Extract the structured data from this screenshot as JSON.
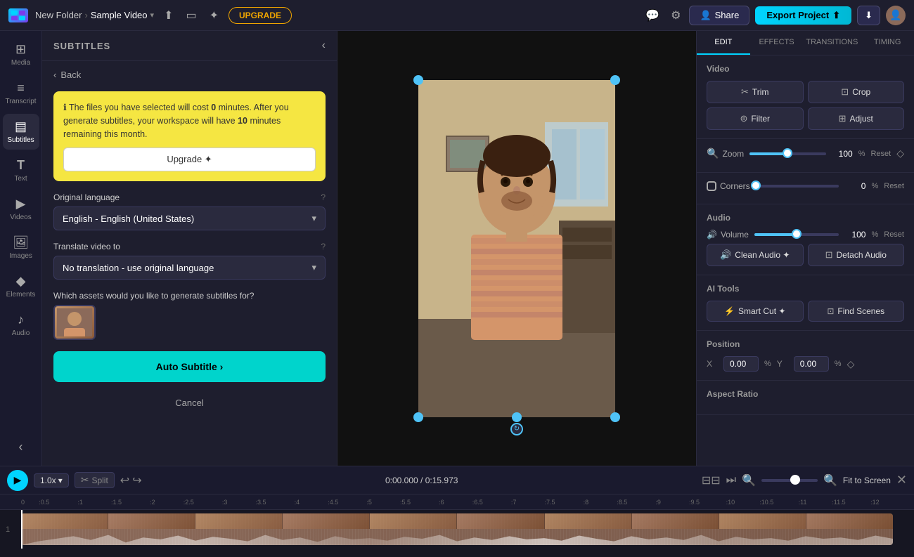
{
  "topbar": {
    "folder": "New Folder",
    "video": "Sample Video",
    "upgrade_label": "UPGRADE",
    "share_label": "Share",
    "export_label": "Export Project",
    "settings_icon": "⚙",
    "download_icon": "⬇",
    "user_icon": "👤"
  },
  "left_sidebar": {
    "items": [
      {
        "id": "media",
        "label": "Media",
        "icon": "⊞"
      },
      {
        "id": "transcript",
        "label": "Transcript",
        "icon": "≡"
      },
      {
        "id": "subtitles",
        "label": "Subtitles",
        "icon": "▤",
        "active": true
      },
      {
        "id": "text",
        "label": "Text",
        "icon": "T"
      },
      {
        "id": "videos",
        "label": "Videos",
        "icon": "▶"
      },
      {
        "id": "images",
        "label": "Images",
        "icon": "🖼"
      },
      {
        "id": "elements",
        "label": "Elements",
        "icon": "◆"
      },
      {
        "id": "audio",
        "label": "Audio",
        "icon": "♪"
      }
    ]
  },
  "subtitles_panel": {
    "title": "SUBTITLES",
    "back_label": "Back",
    "warning": {
      "text": "The files you have selected will cost ",
      "cost": "0",
      "cost_unit": "minutes",
      "after_text": ". After you generate subtitles, your workspace will have ",
      "remaining": "10",
      "remaining_unit": "minutes",
      "remaining_text": "remaining this month.",
      "upgrade_label": "Upgrade ✦"
    },
    "original_language_label": "Original language",
    "original_language_help": "?",
    "original_language_value": "English - English (United States)",
    "translate_label": "Translate video to",
    "translate_help": "?",
    "translate_value": "No translation - use original language",
    "assets_label": "Which assets would you like to generate subtitles for?",
    "auto_subtitle_label": "Auto Subtitle ›",
    "cancel_label": "Cancel"
  },
  "right_panel": {
    "tabs": [
      {
        "id": "edit",
        "label": "EDIT",
        "active": true
      },
      {
        "id": "effects",
        "label": "EFFECTS"
      },
      {
        "id": "transitions",
        "label": "TRANSITIONS"
      },
      {
        "id": "timing",
        "label": "TIMING"
      }
    ],
    "video_section": {
      "title": "Video",
      "trim_label": "Trim",
      "crop_label": "Crop",
      "filter_label": "Filter",
      "adjust_label": "Adjust"
    },
    "zoom": {
      "label": "Zoom",
      "reset_label": "Reset",
      "value": "100",
      "unit": "%"
    },
    "corners": {
      "label": "Corners",
      "reset_label": "Reset",
      "value": "0",
      "unit": "%"
    },
    "audio_section": {
      "title": "Audio",
      "volume_label": "Volume",
      "volume_reset": "Reset",
      "volume_value": "100",
      "volume_unit": "%",
      "clean_audio_label": "Clean Audio ✦",
      "detach_audio_label": "Detach Audio"
    },
    "ai_tools": {
      "title": "AI Tools",
      "smart_cut_label": "Smart Cut ✦",
      "find_scenes_label": "Find Scenes"
    },
    "position": {
      "title": "Position",
      "x_label": "X",
      "x_value": "0.00",
      "x_unit": "%",
      "y_label": "Y",
      "y_value": "0.00",
      "y_unit": "%"
    },
    "aspect_ratio": {
      "title": "Aspect Ratio"
    }
  },
  "timeline": {
    "play_icon": "▶",
    "speed_label": "1.0x",
    "split_label": "Split",
    "undo_icon": "↩",
    "redo_icon": "↪",
    "time_current": "0:00.000",
    "time_total": "/ 0:15.973",
    "fit_screen_label": "Fit to Screen",
    "ruler_marks": [
      {
        "label": "0",
        "pos": 0
      },
      {
        "label": ":0.5",
        "pos": 1
      },
      {
        "label": ":1",
        "pos": 2
      },
      {
        "label": ":1.5",
        "pos": 3
      },
      {
        "label": ":2",
        "pos": 4
      },
      {
        "label": ":2.5",
        "pos": 5
      },
      {
        "label": ":3",
        "pos": 6
      },
      {
        "label": ":3.5",
        "pos": 7
      },
      {
        "label": ":4",
        "pos": 8
      },
      {
        "label": ":4.5",
        "pos": 9
      },
      {
        "label": ":5",
        "pos": 10
      },
      {
        "label": ":5.5",
        "pos": 11
      },
      {
        "label": ":6",
        "pos": 12
      },
      {
        "label": ":6.5",
        "pos": 13
      },
      {
        "label": ":7",
        "pos": 14
      },
      {
        "label": ":7.5",
        "pos": 15
      },
      {
        "label": ":8",
        "pos": 16
      },
      {
        "label": ":8.5",
        "pos": 17
      },
      {
        "label": ":9",
        "pos": 18
      },
      {
        "label": ":9.5",
        "pos": 19
      },
      {
        "label": ":10",
        "pos": 20
      },
      {
        "label": ":10.5",
        "pos": 21
      },
      {
        "label": ":11",
        "pos": 22
      },
      {
        "label": ":11.5",
        "pos": 23
      },
      {
        "label": ":12",
        "pos": 24
      }
    ]
  },
  "colors": {
    "accent_cyan": "#00d4ff",
    "accent_yellow": "#f0a500",
    "warning_bg": "#f5e642",
    "handle_blue": "#4fc3f7",
    "panel_bg": "#1e1e2e",
    "sidebar_bg": "#1a1a2e",
    "track_bg": "#8b6a5a"
  }
}
